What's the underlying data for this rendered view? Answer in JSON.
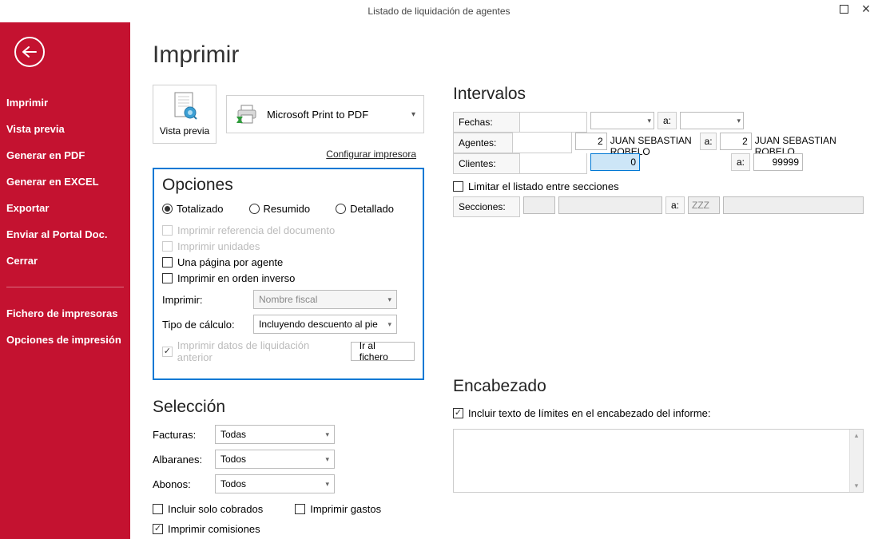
{
  "titlebar": {
    "text": "Listado de liquidación de agentes"
  },
  "sidebar": {
    "items": [
      "Imprimir",
      "Vista previa",
      "Generar en PDF",
      "Generar en EXCEL",
      "Exportar",
      "Enviar al Portal Doc.",
      "Cerrar"
    ],
    "items2": [
      "Fichero de impresoras",
      "Opciones de impresión"
    ]
  },
  "main": {
    "title": "Imprimir",
    "preview_label": "Vista previa",
    "printer_name": "Microsoft Print to PDF",
    "config_link": "Configurar impresora"
  },
  "options": {
    "heading": "Opciones",
    "radios": {
      "total": "Totalizado",
      "resumido": "Resumido",
      "detallado": "Detallado"
    },
    "chk_ref": "Imprimir referencia del documento",
    "chk_unid": "Imprimir unidades",
    "chk_page": "Una página por agente",
    "chk_inv": "Imprimir en orden inverso",
    "lbl_imprimir": "Imprimir:",
    "sel_imprimir": "Nombre fiscal",
    "lbl_tipo": "Tipo de cálculo:",
    "sel_tipo": "Incluyendo descuento al pie",
    "chk_liq": "Imprimir datos de liquidación anterior",
    "btn_ir": "Ir al fichero"
  },
  "seleccion": {
    "heading": "Selección",
    "facturas_lbl": "Facturas:",
    "facturas_val": "Todas",
    "albaranes_lbl": "Albaranes:",
    "albaranes_val": "Todos",
    "abonos_lbl": "Abonos:",
    "abonos_val": "Todos",
    "chk_cobrados": "Incluir solo cobrados",
    "chk_gastos": "Imprimir gastos",
    "chk_comisiones": "Imprimir comisiones"
  },
  "intervalos": {
    "heading": "Intervalos",
    "fechas_lbl": "Fechas:",
    "agentes_lbl": "Agentes:",
    "agentes_from": "2",
    "agentes_from_name": "JUAN SEBASTIAN ROBELO",
    "agentes_to": "2",
    "agentes_to_name": "JUAN SEBASTIAN ROBELO",
    "clientes_lbl": "Clientes:",
    "clientes_from": "0",
    "clientes_to": "99999",
    "a_label": "a:",
    "chk_limitar": "Limitar el listado entre secciones",
    "secciones_lbl": "Secciones:",
    "secciones_to": "ZZZ"
  },
  "encabezado": {
    "heading": "Encabezado",
    "chk_incluir": "Incluir texto de límites en el encabezado del informe:"
  }
}
